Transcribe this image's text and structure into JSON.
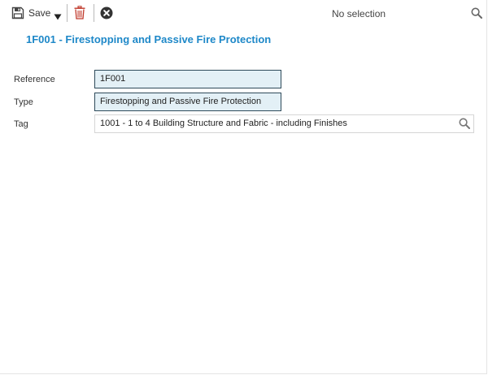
{
  "toolbar": {
    "save_label": "Save",
    "selection_text": "No selection",
    "icons": {
      "save": "floppy-disk-icon",
      "dropdown": "caret-down-icon",
      "delete": "trash-icon",
      "cancel": "close-circle-icon",
      "search": "search-icon"
    }
  },
  "header": {
    "title": "1F001 - Firestopping and Passive Fire Protection"
  },
  "form": {
    "reference": {
      "label": "Reference",
      "value": "1F001"
    },
    "type": {
      "label": "Type",
      "value": "Firestopping and Passive Fire Protection"
    },
    "tag": {
      "label": "Tag",
      "value": "1001 - 1 to 4 Building Structure and Fabric - including Finishes"
    }
  },
  "colors": {
    "accent": "#1e88c8",
    "delete_icon": "#c0392b",
    "readonly_field_bg": "#e3f0f6",
    "readonly_field_border": "#2e4a5a"
  }
}
